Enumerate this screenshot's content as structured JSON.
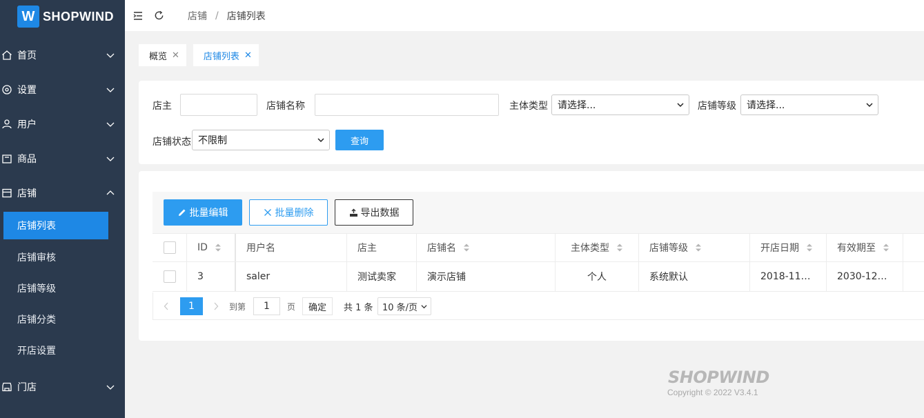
{
  "logo": {
    "mark": "W",
    "text": "SHOPWIND"
  },
  "sidebar": {
    "items": [
      {
        "label": "首页",
        "icon": "home-icon",
        "expanded": false
      },
      {
        "label": "设置",
        "icon": "settings-icon",
        "expanded": false
      },
      {
        "label": "用户",
        "icon": "users-icon",
        "expanded": false
      },
      {
        "label": "商品",
        "icon": "goods-icon",
        "expanded": false
      },
      {
        "label": "店铺",
        "icon": "store-icon",
        "expanded": true
      },
      {
        "label": "门店",
        "icon": "shop-icon",
        "expanded": false
      }
    ],
    "store_submenu": [
      {
        "label": "店铺列表",
        "active": true
      },
      {
        "label": "店铺审核",
        "active": false
      },
      {
        "label": "店铺等级",
        "active": false
      },
      {
        "label": "店铺分类",
        "active": false
      },
      {
        "label": "开店设置",
        "active": false
      }
    ]
  },
  "header": {
    "breadcrumb": [
      "店铺",
      "店铺列表"
    ],
    "separator": "/"
  },
  "tabs": [
    {
      "label": "概览",
      "active": false
    },
    {
      "label": "店铺列表",
      "active": true
    }
  ],
  "search": {
    "owner_label": "店主",
    "owner_value": "",
    "store_name_label": "店铺名称",
    "store_name_value": "",
    "subject_type_label": "主体类型",
    "subject_type_value": "请选择...",
    "store_grade_label": "店铺等级",
    "store_grade_value": "请选择...",
    "store_status_label": "店铺状态",
    "store_status_value": "不限制",
    "query_button": "查询"
  },
  "toolbar": {
    "batch_edit": "批量编辑",
    "batch_delete": "批量删除",
    "export": "导出数据"
  },
  "table": {
    "columns": [
      "ID",
      "用户名",
      "店主",
      "店铺名",
      "主体类型",
      "店铺等级",
      "开店日期",
      "有效期至"
    ],
    "rows": [
      {
        "id": "3",
        "username": "saler",
        "owner": "测试卖家",
        "store_name": "演示店铺",
        "subject_type": "个人",
        "grade": "系统默认",
        "open_date": "2018-11…",
        "expire": "2030-12…"
      }
    ]
  },
  "pagination": {
    "current": "1",
    "goto_label": "到第",
    "goto_value": "1",
    "page_suffix": "页",
    "confirm": "确定",
    "total": "共 1 条",
    "page_size": "10 条/页"
  },
  "footer": {
    "logo": "SHOPWIND",
    "copyright": "Copyright © 2022 V3.4.1"
  },
  "colors": {
    "sidebar_bg": "#2b3a4e",
    "accent": "#1e88e5",
    "button_blue": "#2d9cf0"
  }
}
